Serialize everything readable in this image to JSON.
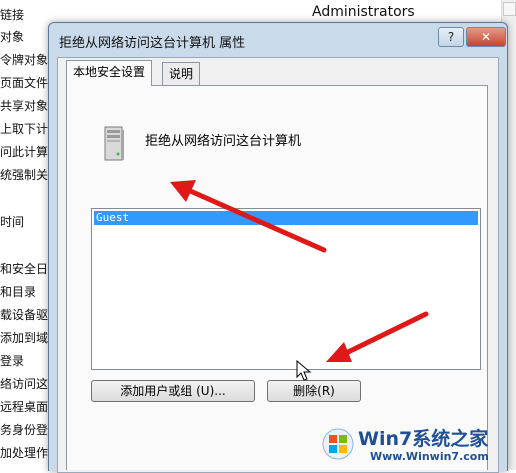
{
  "background": {
    "column_header": "Administrators",
    "policy_items": [
      "链接",
      "对象",
      "令牌对象",
      "页面文件",
      "共享对象",
      "上取下计算",
      "问此计算",
      "统强制关机",
      "",
      "时间",
      "",
      "和安全日志",
      "和目录",
      "载设备驱动",
      "添加到域",
      "登录",
      "络访问这台",
      "远程桌面",
      "务身份登录",
      "加处理作",
      "地登录"
    ]
  },
  "dialog": {
    "title": "拒绝从网络访问这台计算机 属性",
    "help_label": "?",
    "close_label": "✕",
    "tabs": [
      {
        "label": "本地安全设置",
        "active": true
      },
      {
        "label": "说明",
        "active": false
      }
    ],
    "policy_title": "拒绝从网络访问这台计算机",
    "list_items": [
      "Guest"
    ],
    "add_button": "添加用户或组 (U)...",
    "remove_button": "删除(R)"
  },
  "watermark": {
    "brand": "Win7系统之家",
    "url": "Www.Winwin7.com"
  },
  "colors": {
    "selection": "#3399ff",
    "annotation_arrow": "#e01818",
    "dialog_frame": "#c9daea"
  }
}
